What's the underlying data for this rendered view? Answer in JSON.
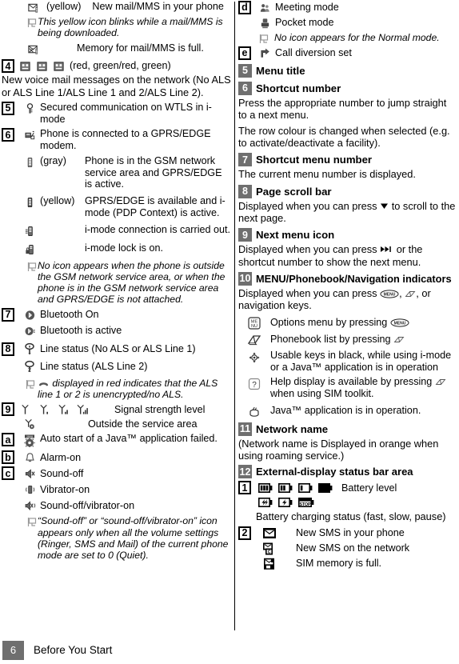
{
  "page": {
    "footer_number": "6",
    "footer_title": "Before You Start"
  },
  "left_column": {
    "rows": [
      {
        "id": "mail-new",
        "icon": "mail-mms-icon",
        "label": "(yellow)",
        "text": "New mail/MMS in your phone"
      },
      {
        "id": "mail-blink-note",
        "icon": "note-flag-icon",
        "text": "This yellow icon blinks while a mail/MMS is being downloaded."
      },
      {
        "id": "mail-memory-full",
        "icon": "mail-memory-full-icon",
        "text": "Memory for mail/MMS is full."
      }
    ],
    "section4": {
      "badge": "4",
      "icons_label": "(red, green/red, green)",
      "text": "New voice mail messages on the network (No ALS or ALS Line 1/ALS Line 1 and 2/ALS Line 2)."
    },
    "section5": {
      "badge": "5",
      "icon": "wtls-key-icon",
      "text": "Secured communication on WTLS in i-mode"
    },
    "section6": {
      "badge": "6",
      "icon": "gprs-modem-icon",
      "text": "Phone is connected to a GPRS/EDGE modem.",
      "sub": [
        {
          "icon": "gprs-gray-icon",
          "label": "(gray)",
          "text": "Phone is in the GSM network service area and GPRS/EDGE is active."
        },
        {
          "icon": "gprs-yellow-icon",
          "label": "(yellow)",
          "text": "GPRS/EDGE is available and i-mode (PDP Context) is active."
        },
        {
          "icon": "imode-connection-icon",
          "label": "",
          "text": "i-mode connection is carried out."
        },
        {
          "icon": "imode-lock-icon",
          "label": "",
          "text": "i-mode lock is on."
        }
      ],
      "note": "No icon appears when the phone is outside the GSM network service area, or when the phone is in the GSM network service area and GPRS/EDGE is not attached."
    },
    "section7": {
      "badge": "7",
      "icon": "bluetooth-on-icon",
      "text": "Bluetooth On",
      "sub": [
        {
          "icon": "bluetooth-active-icon",
          "text": "Bluetooth is active"
        }
      ]
    },
    "section8": {
      "badge": "8",
      "icon": "line-status-1-icon",
      "text": "Line status (No ALS or ALS Line 1)",
      "sub": [
        {
          "icon": "line-status-2-icon",
          "text": "Line status (ALS Line 2)"
        }
      ],
      "note": "displayed in red indicates that the ALS line 1 or 2 is unencrypted/no ALS.",
      "note_icon": "handset-red-icon"
    },
    "section9": {
      "badge": "9",
      "text": "Signal strength level",
      "icons": [
        "signal-0-icon",
        "signal-1-icon",
        "signal-2-icon",
        "signal-3-icon"
      ],
      "sub": [
        {
          "icon": "no-service-icon",
          "text": "Outside the service area"
        }
      ]
    },
    "sectiona": {
      "badge": "a",
      "icon": "java-autostart-failed-icon",
      "text": "Auto start of a Java™ application failed."
    },
    "sectionb": {
      "badge": "b",
      "icon": "alarm-icon",
      "text": "Alarm-on"
    },
    "sectionc": {
      "badge": "c",
      "icon": "sound-off-icon",
      "text": "Sound-off",
      "sub": [
        {
          "icon": "vibrator-on-icon",
          "text": "Vibrator-on"
        },
        {
          "icon": "sound-off-vibrator-on-icon",
          "text": "Sound-off/vibrator-on"
        }
      ],
      "note": "“Sound-off” or “sound-off/vibrator-on” icon appears only when all the volume settings (Ringer, SMS and Mail) of the current phone mode are set to 0 (Quiet)."
    }
  },
  "right_column": {
    "sectiond": {
      "badge": "d",
      "icon": "meeting-mode-icon",
      "text": "Meeting mode",
      "sub": [
        {
          "icon": "pocket-mode-icon",
          "text": "Pocket mode"
        }
      ],
      "note": "No icon appears for the Normal mode."
    },
    "sectione": {
      "badge": "e",
      "icon": "call-diversion-icon",
      "text": "Call diversion set"
    },
    "section5": {
      "badge": "5",
      "title": "Menu title"
    },
    "section6": {
      "badge": "6",
      "title": "Shortcut number",
      "paragraphs": [
        "Press the appropriate number to jump straight to a next menu.",
        "The row colour is changed when selected (e.g. to activate/deactivate a facility)."
      ]
    },
    "section7": {
      "badge": "7",
      "title": "Shortcut menu number",
      "paragraphs": [
        "The current menu number is displayed."
      ]
    },
    "section8": {
      "badge": "8",
      "title": "Page scroll bar",
      "paragraph_prefix": "Displayed when you can press",
      "paragraph_suffix": "to scroll to the next page.",
      "inline_icon": "down-triangle-icon"
    },
    "section9": {
      "badge": "9",
      "title": "Next menu icon",
      "paragraph_prefix": "Displayed when you can press",
      "paragraph_suffix": "or the shortcut number to show the next menu.",
      "inline_icon": "next-track-icon"
    },
    "section10": {
      "badge": "10",
      "title": "MENU/Phonebook/Navigation indicators",
      "paragraph_prefix": "Displayed when you can press",
      "paragraph_mid": ",",
      "paragraph_suffix": ", or navigation keys.",
      "inline_icon_1": "menu-key-icon",
      "inline_icon_2": "phonebook-key-icon",
      "items": [
        {
          "icon": "menu-box-icon",
          "text_prefix": "Options menu by pressing",
          "trailing_icon": "menu-key-icon",
          "text_suffix": ""
        },
        {
          "icon": "phonebook-book-icon",
          "text_prefix": "Phonebook list by pressing",
          "trailing_icon": "phonebook-key-icon",
          "text_suffix": ""
        },
        {
          "icon": "navigation-keys-icon",
          "text_prefix": "Usable keys in black, while using i-mode or a Java™ application is in operation",
          "trailing_icon": "",
          "text_suffix": ""
        },
        {
          "icon": "help-question-icon",
          "text_prefix": "Help display is available by pressing",
          "trailing_icon": "phonebook-key-icon",
          "text_suffix": "when using SIM toolkit."
        },
        {
          "icon": "java-running-icon",
          "text_prefix": "Java™ application is in operation.",
          "trailing_icon": "",
          "text_suffix": ""
        }
      ]
    },
    "section11": {
      "badge": "11",
      "title": "Network name",
      "paragraphs": [
        "(Network name is Displayed in orange when using roaming service.)"
      ]
    },
    "section12": {
      "badge": "12",
      "title": "External-display status bar area",
      "item1": {
        "badge": "1",
        "label": "Battery level",
        "battery_icons": [
          "battery-full-icon",
          "battery-two-thirds-icon",
          "battery-one-third-icon",
          "battery-empty-icon"
        ],
        "charging_icons": [
          "charging-fast-icon",
          "charging-slow-icon",
          "charging-pause-icon"
        ],
        "charging_label": "Battery charging status (fast, slow, pause)"
      },
      "item2": {
        "badge": "2",
        "rows": [
          {
            "icon": "sms-new-icon",
            "text": "New SMS in your phone"
          },
          {
            "icon": "sms-network-icon",
            "text": "New SMS on the network"
          },
          {
            "icon": "sim-full-icon",
            "text": "SIM memory is full."
          }
        ]
      }
    }
  }
}
